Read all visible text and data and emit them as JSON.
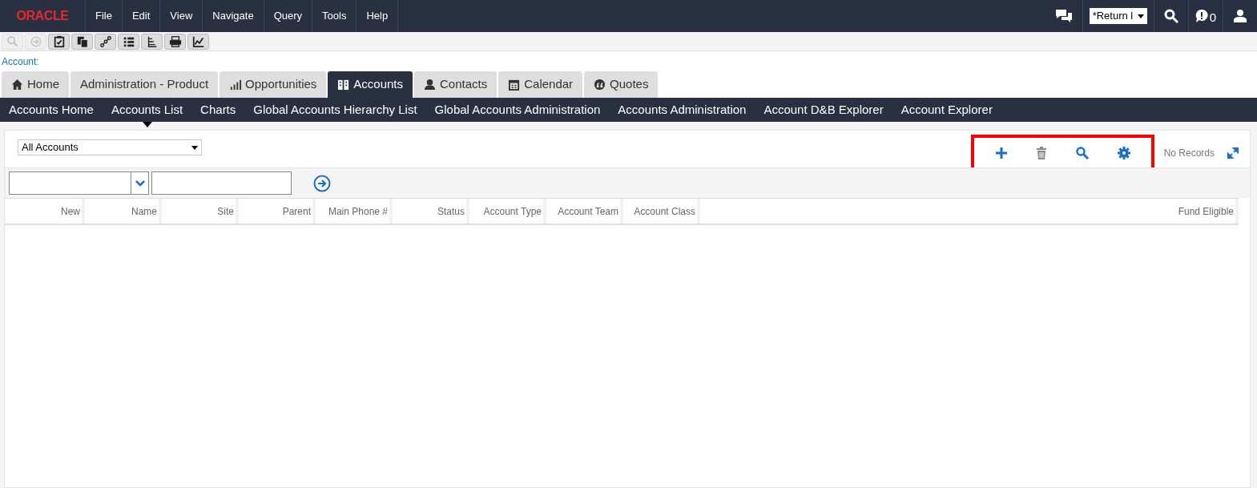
{
  "logo": "ORACLE",
  "menu": [
    "File",
    "Edit",
    "View",
    "Navigate",
    "Query",
    "Tools",
    "Help"
  ],
  "header": {
    "return_dropdown": "*Return l",
    "notification_count": "0"
  },
  "toolbar": [
    {
      "disabled": true
    },
    {
      "disabled": true
    },
    {
      "disabled": false
    },
    {
      "disabled": false
    },
    {
      "disabled": false
    },
    {
      "disabled": false
    },
    {
      "disabled": false
    },
    {
      "disabled": false
    },
    {
      "disabled": false
    }
  ],
  "breadcrumb": "Account:",
  "tabs": [
    {
      "label": "Home",
      "selected": false
    },
    {
      "label": "Administration - Product",
      "selected": false
    },
    {
      "label": "Opportunities",
      "selected": false
    },
    {
      "label": "Accounts",
      "selected": true
    },
    {
      "label": "Contacts",
      "selected": false
    },
    {
      "label": "Calendar",
      "selected": false
    },
    {
      "label": "Quotes",
      "selected": false
    }
  ],
  "subtabs": [
    {
      "label": "Accounts Home",
      "selected": false
    },
    {
      "label": "Accounts List",
      "selected": true
    },
    {
      "label": "Charts",
      "selected": false
    },
    {
      "label": "Global Accounts Hierarchy List",
      "selected": false
    },
    {
      "label": "Global Accounts Administration",
      "selected": false
    },
    {
      "label": "Accounts Administration",
      "selected": false
    },
    {
      "label": "Account D&B Explorer",
      "selected": false
    },
    {
      "label": "Account Explorer",
      "selected": false
    }
  ],
  "list": {
    "visibility": "All Accounts",
    "record_count": "No Records"
  },
  "columns": [
    "New",
    "Name",
    "Site",
    "Parent",
    "Main Phone #",
    "Status",
    "Account Type",
    "Account Team",
    "Account Class",
    "Fund Eligible"
  ]
}
